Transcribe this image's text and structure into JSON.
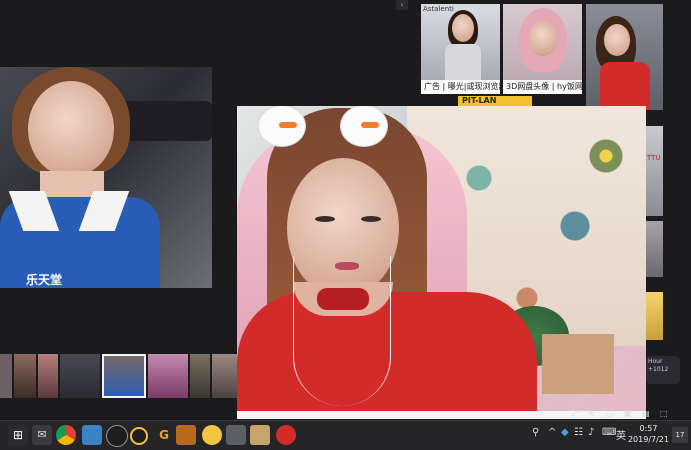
{
  "top_thumbnails": [
    {
      "caption": "广告 | 曝光|或现浏览器缓存..."
    },
    {
      "caption": "3D网盘头像 | hy饭网"
    },
    {
      "caption": ""
    }
  ],
  "banner_text": "PIT-LAN",
  "logo_text": "Astalenti",
  "left_photo": {
    "shirt_text": "乐天堂"
  },
  "right_strip": {
    "tag1": "TTU",
    "tag2": "Hour",
    "tag3": "+1012"
  },
  "taskbar": {
    "clock_time": "0:57",
    "clock_date": "2019/7/21",
    "tray_icons": [
      "network-icon",
      "shield-icon",
      "volume-icon",
      "keyboard-icon"
    ],
    "notification_count": "17"
  },
  "colors": {
    "taskbar_bg": "#252528",
    "page_bg": "#1b1b1d",
    "accent_red": "#d32a2a"
  }
}
